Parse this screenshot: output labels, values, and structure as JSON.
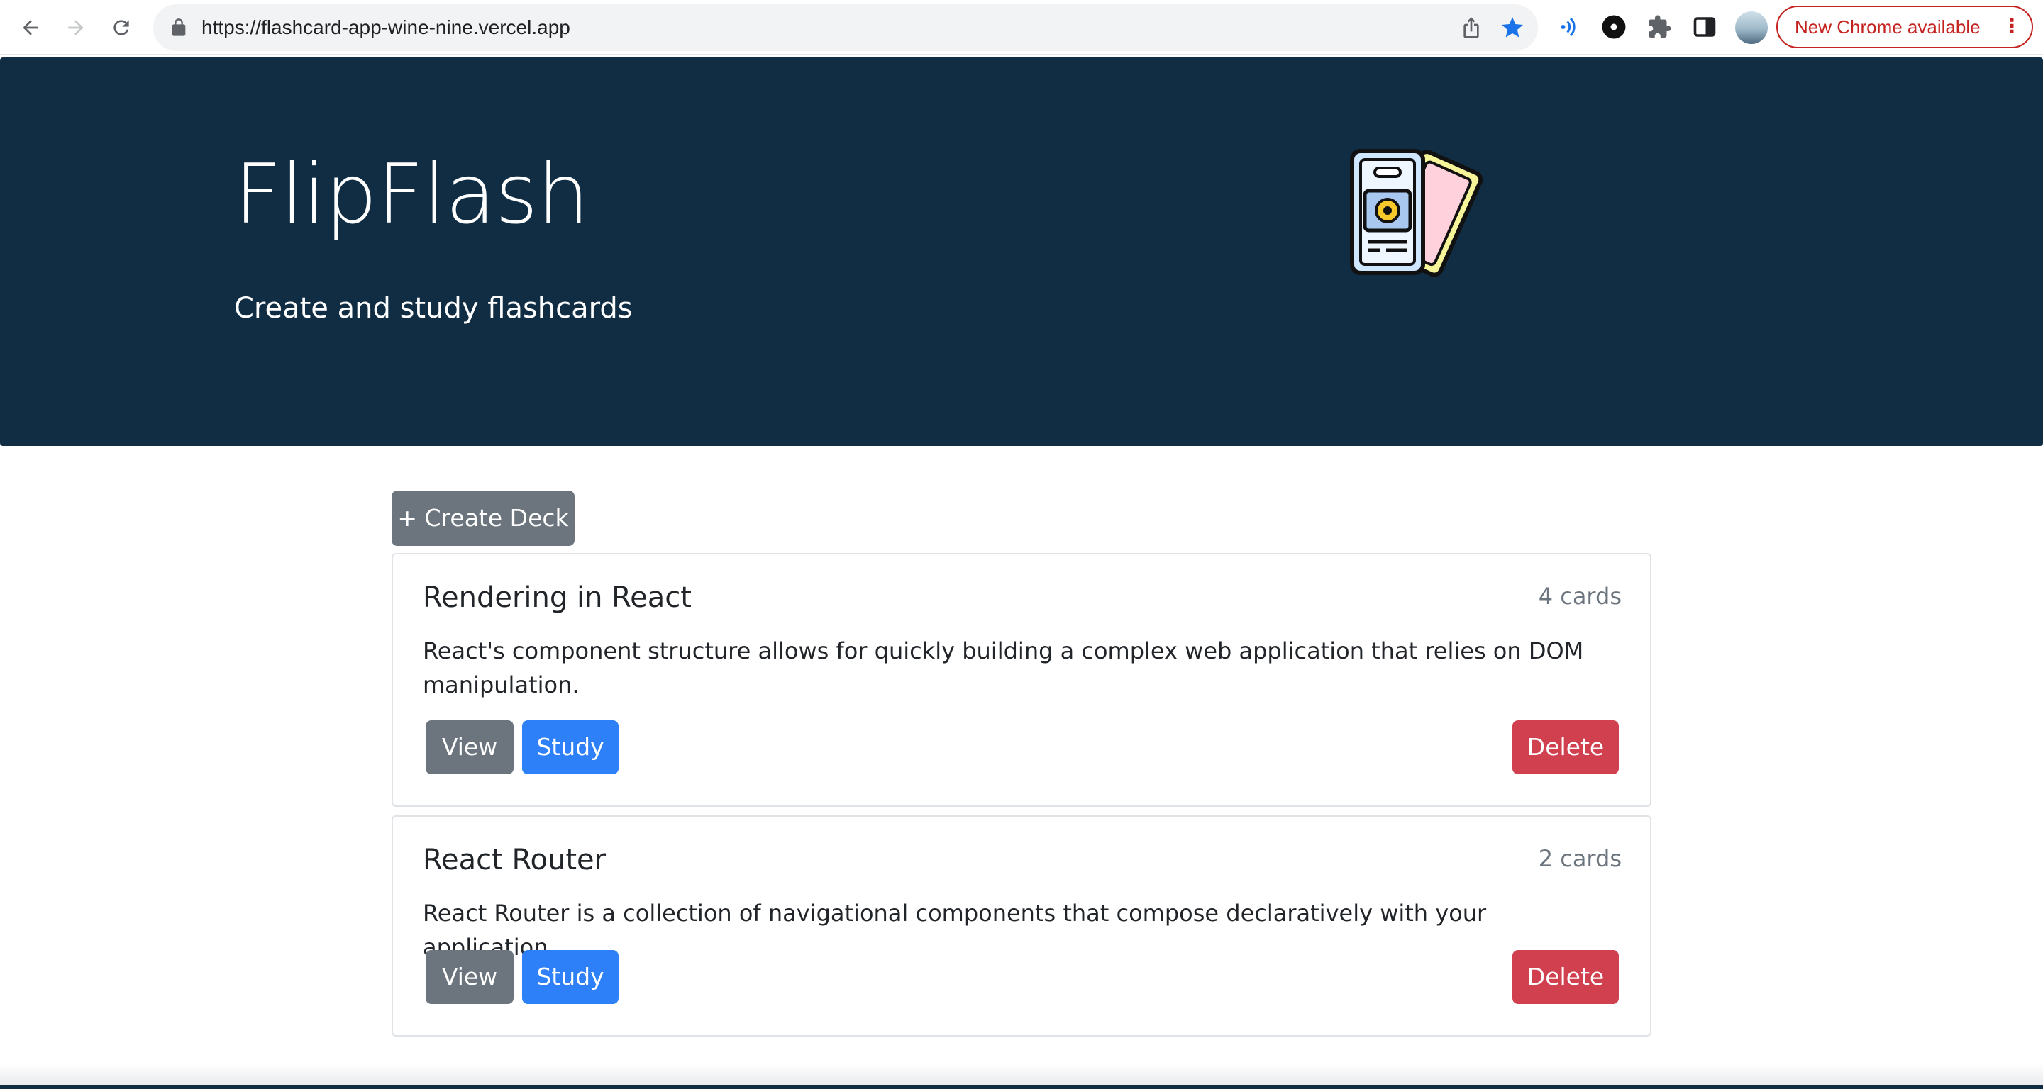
{
  "browser": {
    "url": "https://flashcard-app-wine-nine.vercel.app",
    "update_label": "New Chrome available",
    "menu_glyph": "⋮"
  },
  "hero": {
    "title": "FlipFlash",
    "subtitle": "Create and study flashcards"
  },
  "main": {
    "create_label": "+ Create Deck",
    "decks": [
      {
        "name": "Rendering in React",
        "count": "4 cards",
        "description": "React's component structure allows for quickly building a complex web application that relies on DOM manipulation.",
        "view_label": "View",
        "study_label": "Study",
        "delete_label": "Delete"
      },
      {
        "name": "React Router",
        "count": "2 cards",
        "description": "React Router is a collection of navigational components that compose declaratively with your application.",
        "view_label": "View",
        "study_label": "Study",
        "delete_label": "Delete"
      }
    ]
  },
  "colors": {
    "hero_bg": "#102d44",
    "secondary": "#6c757d",
    "primary": "#2d80f7",
    "danger": "#d1404f"
  }
}
